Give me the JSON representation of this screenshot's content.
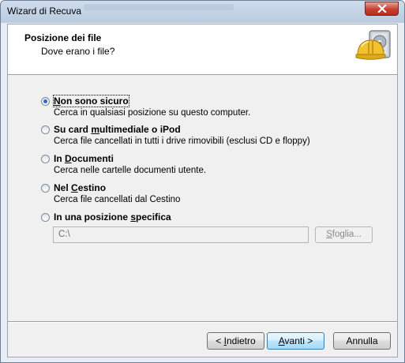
{
  "window": {
    "title": "Wizard di Recuva"
  },
  "header": {
    "title": "Posizione dei file",
    "subtitle": "Dove erano i file?",
    "icon": "hard-drive-hardhat-icon"
  },
  "options": [
    {
      "pre": "",
      "acc": "N",
      "post": "on sono sicuro",
      "description": "Cerca in qualsiasi posizione su questo computer.",
      "checked": true
    },
    {
      "pre": "Su card ",
      "acc": "m",
      "post": "ultimediale o iPod",
      "description": "Cerca file cancellati in tutti i drive rimovibili (esclusi CD e floppy)",
      "checked": false
    },
    {
      "pre": "In ",
      "acc": "D",
      "post": "ocumenti",
      "description": "Cerca nelle cartelle documenti utente.",
      "checked": false
    },
    {
      "pre": "Nel ",
      "acc": "C",
      "post": "estino",
      "description": "Cerca file cancellati dal Cestino",
      "checked": false
    },
    {
      "pre": "In una posizione ",
      "acc": "s",
      "post": "pecifica",
      "description": "",
      "checked": false
    }
  ],
  "path": {
    "value": "C:\\"
  },
  "browse": {
    "pre": "",
    "acc": "S",
    "post": "foglia..."
  },
  "buttons": {
    "back": {
      "pre": "< ",
      "acc": "I",
      "post": "ndietro"
    },
    "next": {
      "pre": "",
      "acc": "A",
      "post": "vanti >"
    },
    "cancel": {
      "label": "Annulla"
    }
  },
  "colors": {
    "radio_dot": "#2a6bc9",
    "close_button": "#c7402f"
  }
}
